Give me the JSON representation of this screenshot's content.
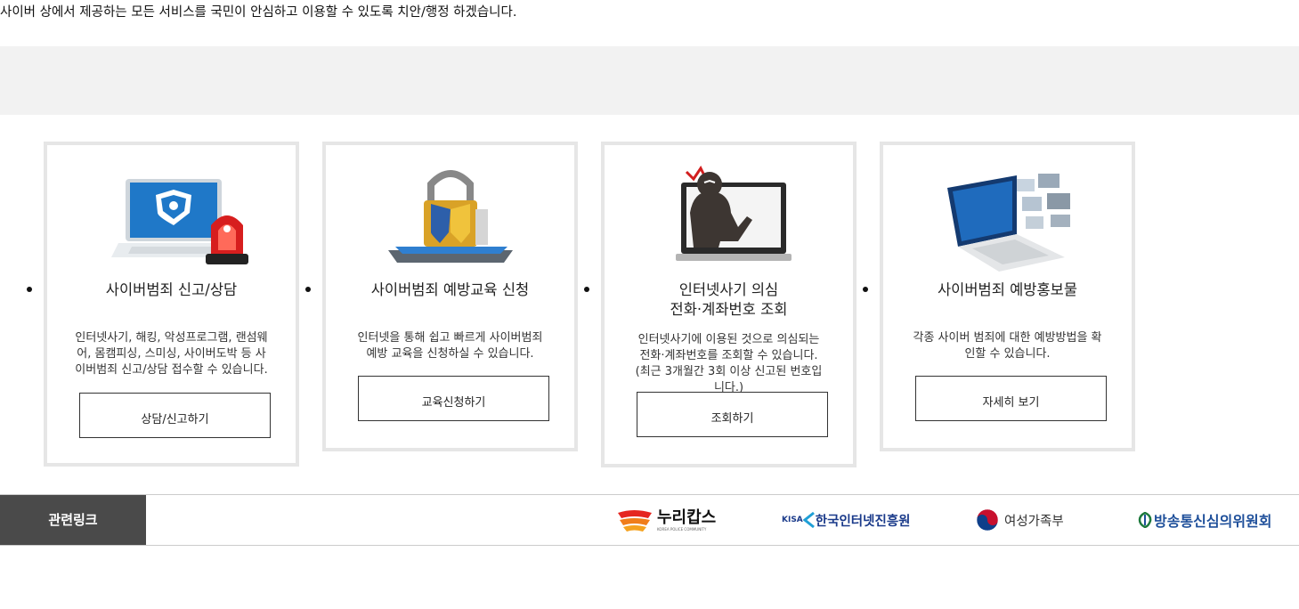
{
  "intro_text": "사이버 상에서 제공하는 모든 서비스를 국민이 안심하고 이용할 수 있도록 치안/행정 하겠습니다.",
  "cards": [
    {
      "title": "사이버범죄 신고/상담",
      "desc": "인터넷사기, 해킹, 악성프로그램, 랜섬웨어, 몸캠피싱, 스미싱, 사이버도박 등 사이버범죄 신고/상담 접수할 수 있습니다.",
      "button": "상담/신고하기",
      "icon": "laptop-police-siren-icon"
    },
    {
      "title": "사이버범죄 예방교육 신청",
      "desc": "인터넷을 통해 쉽고 빠르게 사이버범죄 예방 교육을 신청하실 수 있습니다.",
      "button": "교육신청하기",
      "icon": "tablet-padlock-shield-icon"
    },
    {
      "title_line1": "인터넷사기 의심",
      "title_line2": "전화·계좌번호 조회",
      "desc": "인터넷사기에 이용된 것으로 의심되는 전화·계좌번호를 조회할 수 있습니다. (최근 3개월간 3회 이상 신고된 번호입니다.)",
      "button": "조회하기",
      "icon": "hacker-monitor-icon"
    },
    {
      "title": "사이버범죄 예방홍보물",
      "desc": "각종 사이버 범죄에 대한 예방방법을 확인할 수 있습니다.",
      "button": "자세히 보기",
      "icon": "laptop-digital-screens-icon"
    }
  ],
  "footer": {
    "related_label": "관련링크",
    "links": [
      {
        "name": "누리캅스",
        "sub": "KOREA POLICE COMMUNITY"
      },
      {
        "name": "한국인터넷진흥원",
        "prefix": "KISA"
      },
      {
        "name": "여성가족부"
      },
      {
        "name": "방송통신심의위원회"
      }
    ]
  },
  "colors": {
    "card_border": "#e6e6e6",
    "band": "#f2f2f2",
    "footer_label_bg": "#4a4a4a"
  }
}
